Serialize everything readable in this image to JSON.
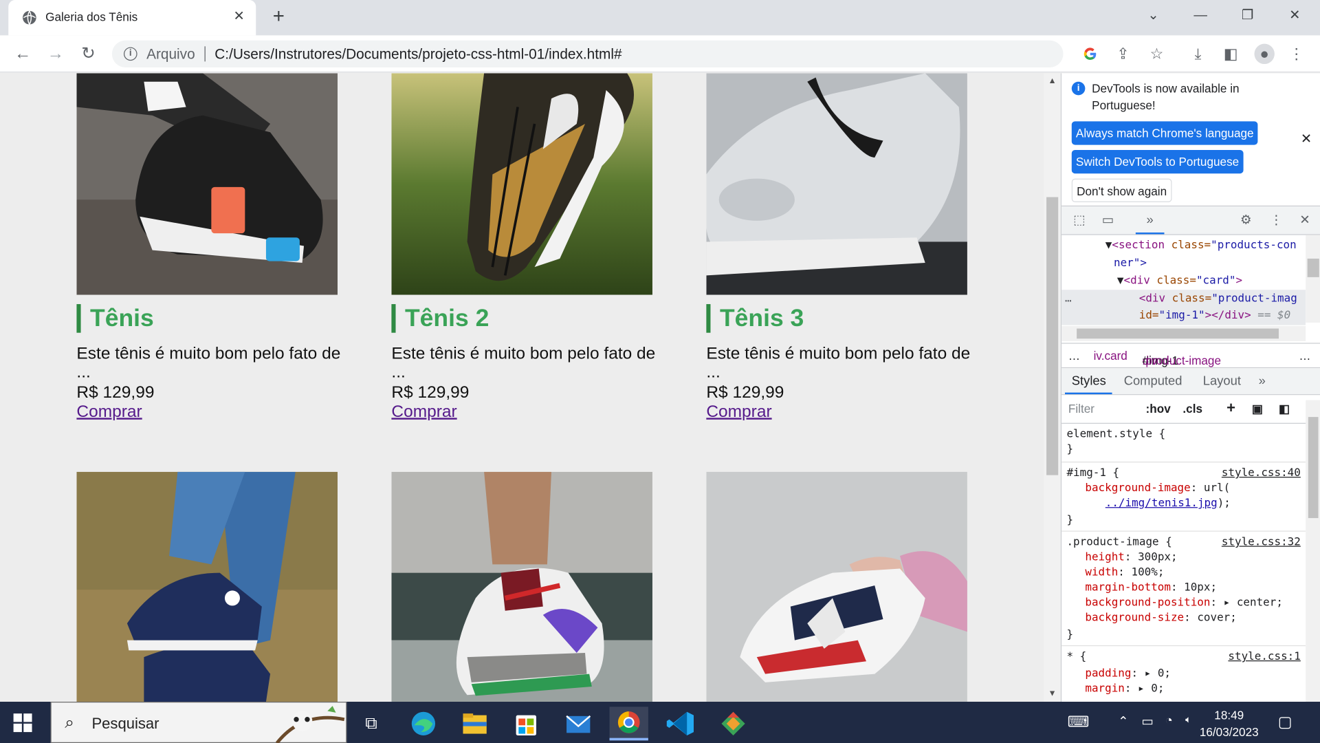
{
  "browser": {
    "tab_title": "Galeria dos Tênis",
    "tab_close": "✕",
    "new_tab": "+",
    "address": {
      "scheme": "Arquivo",
      "url": "C:/Users/Instrutores/Documents/projeto-css-html-01/index.html#"
    }
  },
  "page": {
    "cards": [
      {
        "title": "Tênis",
        "description": "Este tênis é muito bom pelo fato de ...",
        "price": "R$ 129,99",
        "buy": "Comprar"
      },
      {
        "title": "Tênis 2",
        "description": "Este tênis é muito bom pelo fato de ...",
        "price": "R$ 129,99",
        "buy": "Comprar"
      },
      {
        "title": "Tênis 3",
        "description": "Este tênis é muito bom pelo fato de ...",
        "price": "R$ 129,99",
        "buy": "Comprar"
      }
    ]
  },
  "devtools": {
    "infobar": {
      "message": "DevTools is now available in Portuguese!",
      "btn_match": "Always match Chrome's language",
      "btn_switch": "Switch DevTools to Portuguese",
      "btn_dont": "Don't show again"
    },
    "dom": {
      "l1_tag": "<section",
      "l1_attr": "class=",
      "l1_val": "\"products-con",
      "l2": "ner\">",
      "l3_tag": "<div",
      "l3_attr": "class=",
      "l3_val": "\"card\"",
      "l3_end": ">",
      "l4_tag": "<div",
      "l4_attr": "class=",
      "l4_val": "\"product-imag",
      "l5_attr": "id=",
      "l5_val": "\"img-1\"",
      "l5_end": "></div>",
      "l5_dim": "== $0",
      "ellipsis": "…"
    },
    "breadcrumb": {
      "more": "…",
      "c1": "iv.card",
      "c2_tag": "div",
      "c2_id": "#img-1",
      "c2_class": ".product-image",
      "more2": "…"
    },
    "subtabs": [
      "Styles",
      "Computed",
      "Layout",
      "»"
    ],
    "filter": {
      "placeholder": "Filter",
      "hov": ":hov",
      "cls": ".cls",
      "plus": "+"
    },
    "styles": {
      "r0_sel": "element.style {",
      "r0_end": "}",
      "r1_sel": "#img-1 {",
      "r1_src": "style.css:40",
      "r1_p1": "background-image",
      "r1_v1a": "url(",
      "r1_v1b": "../img/tenis1.jpg",
      "r1_v1c": ");",
      "r1_end": "}",
      "r2_sel": ".product-image {",
      "r2_src": "style.css:32",
      "r2_p1": "height",
      "r2_v1": "300px;",
      "r2_p2": "width",
      "r2_v2": "100%;",
      "r2_p3": "margin-bottom",
      "r2_v3": "10px;",
      "r2_p4": "background-position",
      "r2_v4": "center;",
      "r2_p5": "background-size",
      "r2_v5": "cover;",
      "r2_end": "}",
      "r3_sel": "* {",
      "r3_src": "style.css:1",
      "r3_p1": "padding",
      "r3_v1": "0;",
      "r3_p2": "margin",
      "r3_v2": "0;"
    }
  },
  "taskbar": {
    "search_placeholder": "Pesquisar",
    "time": "18:49",
    "date": "16/03/2023"
  },
  "colors": {
    "accent_green": "#3aa357",
    "link_visited": "#551a8b",
    "devtools_blue": "#1a73e8"
  }
}
